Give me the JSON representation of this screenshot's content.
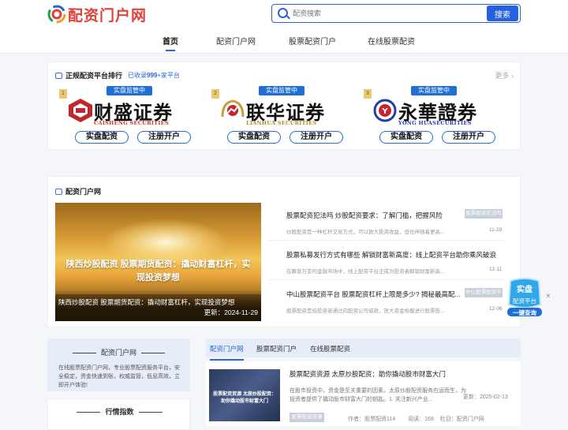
{
  "site": {
    "name": "配资门户网"
  },
  "search": {
    "placeholder": "配资搜索",
    "button": "搜索"
  },
  "nav": {
    "items": [
      "首页",
      "配资门户网",
      "股票配资门户",
      "在线股票配资"
    ],
    "active": 0
  },
  "ranking": {
    "title": "正规配资平台排行",
    "subtitle_prefix": "已收录",
    "count": "999",
    "subtitle_suffix": "+家平台",
    "more": "更多",
    "brokers": [
      {
        "rank": "1",
        "badge": "实盘监管中",
        "name": "财盛证券",
        "english": "CAISHENG SECURITIES",
        "btn1": "实盘配资",
        "btn2": "注册开户",
        "icon": "caisheng-logo-icon",
        "color": "#c4262e"
      },
      {
        "rank": "2",
        "badge": "实盘监管中",
        "name": "联华证券",
        "english": "LIANHUA SECURITIES",
        "btn1": "实盘配资",
        "btn2": "注册开户",
        "icon": "lianhua-logo-icon",
        "color": "#c4262e"
      },
      {
        "rank": "3",
        "badge": "实盘监管中",
        "name": "永華證券",
        "english": "YONG HUASECURITIES",
        "btn1": "实盘配资",
        "btn2": "注册开户",
        "icon": "yonghua-logo-icon",
        "color": "#1f3fa8"
      }
    ]
  },
  "portal": {
    "title": "配资门户网",
    "hero": {
      "headline": "陕西炒股配资 股票期货配资：撬动财富杠杆，实现投资梦想",
      "caption": "陕西炒股配资 股票期货配资：撬动财富杠杆，实现投资梦想",
      "date": "更新：2024-11-29"
    },
    "news": [
      {
        "title": "股票配资犯法吗 炒股配资要求：了解门槛，把握风险",
        "tag": "股票配资犯法吗",
        "desc": "炒股配资是一种杠杆交易方式，可以放大投资收益，但也伴随着更高...",
        "date": "11-29"
      },
      {
        "title": "股票私募发行方式有哪些 解锁财富新高度：线上配资平台助你乘风破浪",
        "tag": "",
        "desc": "在瞬息万变的金融市场中，线上配资平台正成为投资者解锁财富新高...",
        "date": "12-11"
      },
      {
        "title": "中山股票配资平台 股票配资杠杆上限是多少? 揭秘最高配...",
        "tag": "中山股票配资平台",
        "desc": "股票配资是指投资者通过向配资公司借款，放大资金规模进行股票投...",
        "date": "12-06"
      }
    ]
  },
  "float_widget": {
    "line1": "实盘",
    "line2": "配资平台",
    "line3": "一键查询",
    "close": "×"
  },
  "sidebar": {
    "about_title": "配资门户网",
    "about_desc": "在线股票配资门户网，专业股票配资服务平台，安全稳定，资金快速到账，权威监管，低息高效，立即开户体验!",
    "index_title": "行情指数"
  },
  "tabs": {
    "items": [
      "配资门户网",
      "股票配资门户",
      "在线股票配资"
    ],
    "active": 0
  },
  "article": {
    "thumb_text": "股票配资资源 太原炒股配资：助你撬动股市财富大门",
    "title": "股票配资资源 太原炒股配资：助你撬动股市财富大门",
    "desc": "在股市投资中，资金是至关重要的因素。太原炒股配资服务应运而生，为投资者提供了撬动股市财富大门的钥匙。1. 关注新兴产业...",
    "date": "更新：2025-02-13",
    "tag": "股票配资资源",
    "author": "作者：股票配资114",
    "reads": "阅读：169",
    "column": "栏目：配资门户网"
  }
}
